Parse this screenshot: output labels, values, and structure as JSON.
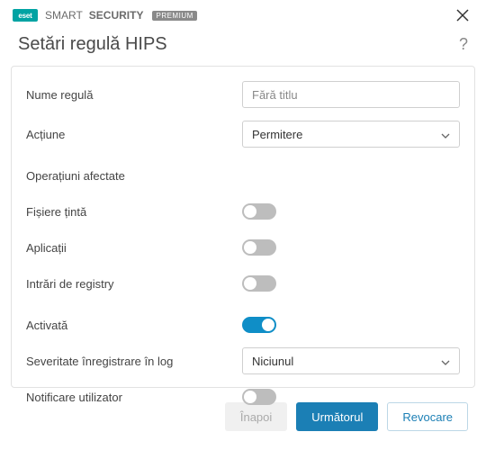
{
  "brand": {
    "logo_text": "eset",
    "smart": "SMART",
    "security": "SECURITY",
    "premium": "PREMIUM"
  },
  "page": {
    "title": "Setări regulă HIPS"
  },
  "form": {
    "rule_name_label": "Nume regulă",
    "rule_name_placeholder": "Fără titlu",
    "rule_name_value": "",
    "action_label": "Acțiune",
    "action_value": "Permitere",
    "affected_ops_label": "Operațiuni afectate",
    "target_files_label": "Fișiere țintă",
    "target_files_on": false,
    "applications_label": "Aplicații",
    "applications_on": false,
    "registry_label": "Intrări de registry",
    "registry_on": false,
    "enabled_label": "Activată",
    "enabled_on": true,
    "log_severity_label": "Severitate înregistrare în log",
    "log_severity_value": "Niciunul",
    "notify_user_label": "Notificare utilizator",
    "notify_user_on": false
  },
  "footer": {
    "back": "Înapoi",
    "next": "Următorul",
    "cancel": "Revocare"
  }
}
